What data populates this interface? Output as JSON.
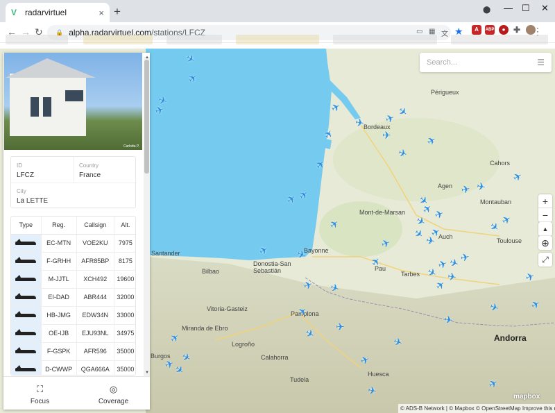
{
  "browser": {
    "tab_title": "radarvirtuel",
    "url_host": "alpha.radarvirtuel.com",
    "url_path": "/stations/LFCZ",
    "new_tab": "+",
    "tab_close": "×",
    "back": "←",
    "forward": "→",
    "reload": "↻",
    "lock": "🔒",
    "menu": "⋮",
    "minimize": "—",
    "maximize": "☐",
    "close": "✕",
    "ext_abp": "ABP"
  },
  "map": {
    "search_placeholder": "Search...",
    "zoom_in": "+",
    "zoom_out": "−",
    "compass": "▲",
    "locate": "⊕",
    "fullscreen": "⤢",
    "attribution": "© ADS-B Network | © Mapbox © OpenStreetMap Improve this map",
    "mapbox_logo": "mapbox",
    "places": [
      {
        "name": "Périgueux",
        "big": false
      },
      {
        "name": "Cahors",
        "big": false
      },
      {
        "name": "Agen",
        "big": false
      },
      {
        "name": "Montauban",
        "big": false
      },
      {
        "name": "Mont-de-Marsan",
        "big": false
      },
      {
        "name": "Auch",
        "big": false
      },
      {
        "name": "Toulouse",
        "big": false
      },
      {
        "name": "Pau",
        "big": false
      },
      {
        "name": "Tarbes",
        "big": false
      },
      {
        "name": "Bilbao",
        "big": false
      },
      {
        "name": "Donostia-San Sebastián",
        "big": false
      },
      {
        "name": "Vitoria-Gasteiz",
        "big": false
      },
      {
        "name": "Pamplona",
        "big": false
      },
      {
        "name": "Logroño",
        "big": false
      },
      {
        "name": "Burgos",
        "big": false
      },
      {
        "name": "Calahorra",
        "big": false
      },
      {
        "name": "Tudela",
        "big": false
      },
      {
        "name": "Huesca",
        "big": false
      },
      {
        "name": "Andorra",
        "big": true
      },
      {
        "name": "Miranda de Ebro",
        "big": false
      },
      {
        "name": "Bordeaux",
        "big": false
      },
      {
        "name": "Bayonne",
        "big": false
      },
      {
        "name": "Santander",
        "big": false
      }
    ]
  },
  "station": {
    "id_label": "ID",
    "id_value": "LFCZ",
    "country_label": "Country",
    "country_value": "France",
    "city_label": "City",
    "city_value": "La LETTE",
    "photo_credit": "Carlotta P."
  },
  "flights": {
    "headers": [
      "Type",
      "Reg.",
      "Callsign",
      "Alt."
    ],
    "rows": [
      {
        "reg": "EC-MTN",
        "callsign": "VOE2KU",
        "alt": "7975"
      },
      {
        "reg": "F-GRHH",
        "callsign": "AFR85BP",
        "alt": "8175"
      },
      {
        "reg": "M-JJTL",
        "callsign": "XCH492",
        "alt": "19600"
      },
      {
        "reg": "EI-DAD",
        "callsign": "ABR444",
        "alt": "32000"
      },
      {
        "reg": "HB-JMG",
        "callsign": "EDW34N",
        "alt": "33000"
      },
      {
        "reg": "OE-IJB",
        "callsign": "EJU93NL",
        "alt": "34975"
      },
      {
        "reg": "F-GSPK",
        "callsign": "AFR596",
        "alt": "35000"
      },
      {
        "reg": "D-CWWP",
        "callsign": "QGA666A",
        "alt": "35000"
      }
    ]
  },
  "footer": {
    "focus_label": "Focus",
    "coverage_label": "Coverage"
  }
}
